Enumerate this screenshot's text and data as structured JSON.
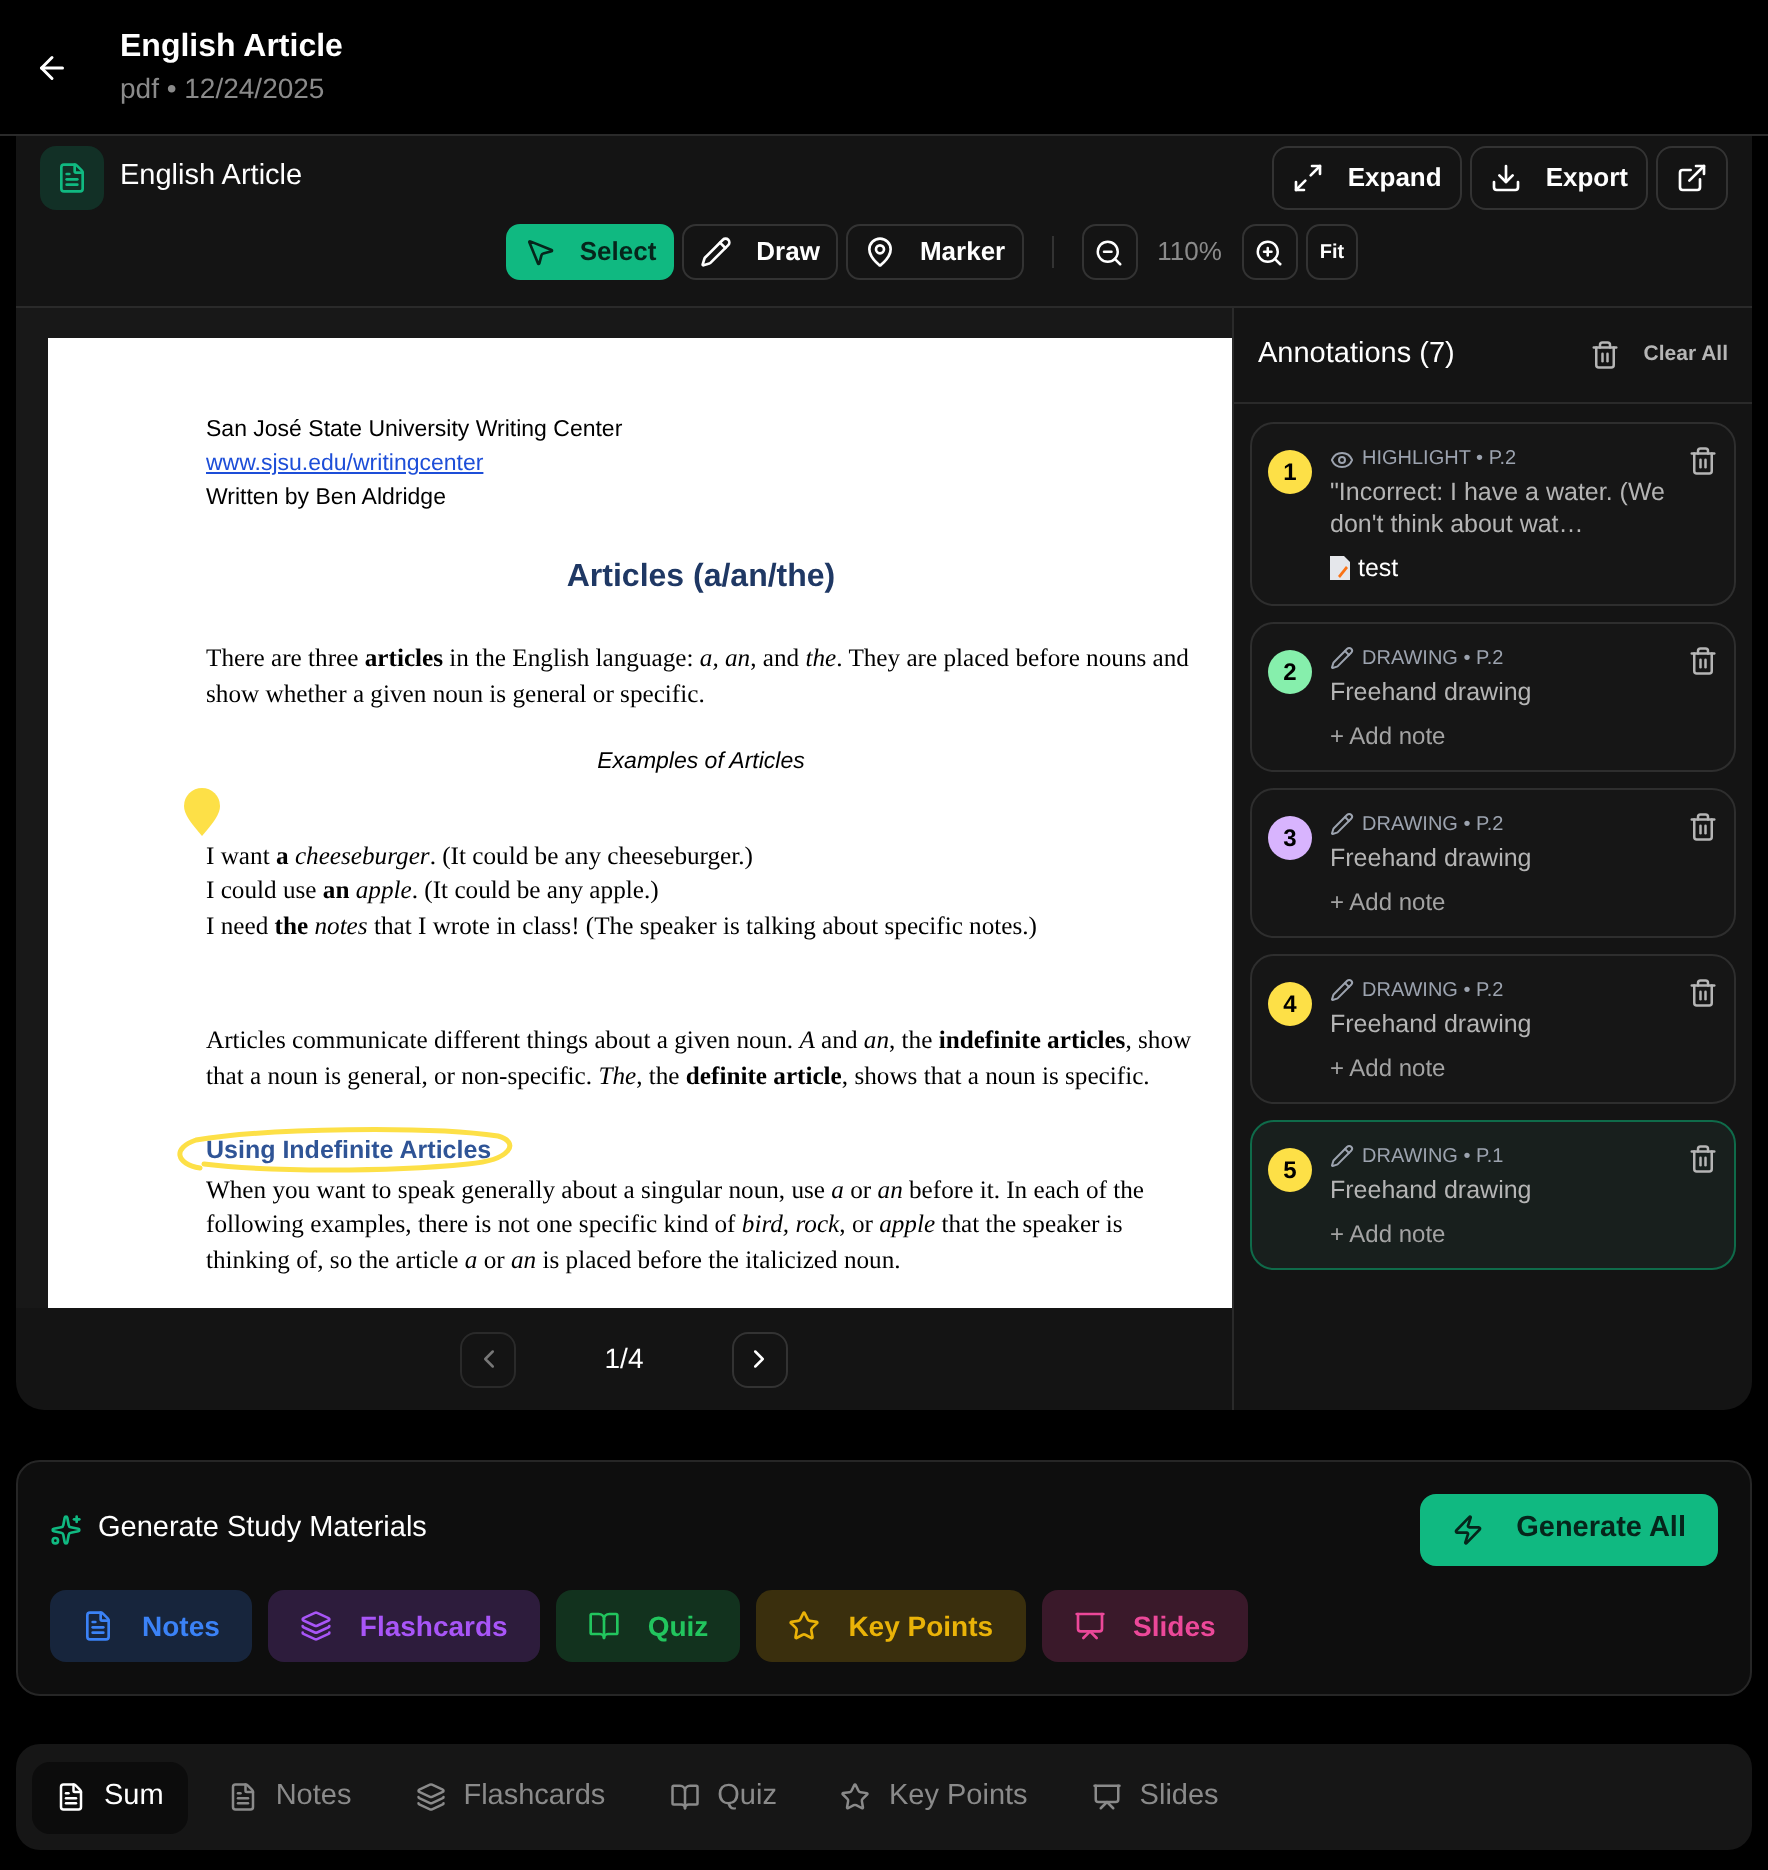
{
  "header": {
    "title": "English Article",
    "subtitle": "pdf • 12/24/2025"
  },
  "viewer": {
    "title": "English Article",
    "actions": [
      {
        "kind": "expand",
        "label": "Expand"
      },
      {
        "kind": "export",
        "label": "Export"
      },
      {
        "kind": "external"
      }
    ],
    "tools": [
      {
        "kind": "select",
        "label": "Select",
        "selected": true
      },
      {
        "kind": "draw",
        "label": "Draw",
        "selected": false
      },
      {
        "kind": "marker",
        "label": "Marker",
        "selected": false
      }
    ],
    "zoom": "110%",
    "fit": "Fit",
    "document": {
      "header_lines": [
        "San José State University Writing Center",
        "www.sjsu.edu/writingcenter",
        "Written by Ben Aldridge"
      ],
      "title": "Articles (a/an/the)",
      "blocks": [
        {
          "kind": "para",
          "text": "There are three **articles** in the English language: *a, an*, and *the*. They are placed before nouns and show whether a given noun is general or specific."
        },
        {
          "kind": "caption",
          "text": "Examples of Articles"
        },
        {
          "kind": "lines",
          "marker": true,
          "lines": [
            "I want **a** *cheeseburger*. (It could be any cheeseburger.)",
            "I could use **an** *apple*. (It could be any apple.)",
            "I need **the** *notes* that I wrote in class! (The speaker is talking about specific notes.)"
          ]
        },
        {
          "kind": "para",
          "text": "Articles communicate different things about a given noun. *A* and *an*, the **indefinite articles**, show that a noun is general, or non-specific. *The*, the **definite article**, shows that a noun is specific."
        },
        {
          "kind": "heading",
          "circled": true,
          "text": "Using Indefinite Articles"
        },
        {
          "kind": "para",
          "text": "When you want to speak generally about a singular noun, use *a* or *an* before it. In each of the following examples, there is not one specific kind of *bird, rock*, or *apple* that the speaker is thinking of, so the article *a* or *an* is placed before the italicized noun."
        }
      ]
    },
    "page": "1/4"
  },
  "annotations": {
    "title": "Annotations (7)",
    "clear_label": "Clear All",
    "items": [
      {
        "number": "1",
        "color": "#fde047",
        "kind": "highlight",
        "meta": "HIGHLIGHT • P.2",
        "text": "\"Incorrect: I have a water. (We don't think about wat…",
        "note": "test",
        "selected": false
      },
      {
        "number": "2",
        "color": "#86efac",
        "kind": "drawing",
        "meta": "DRAWING • P.2",
        "text": "Freehand drawing",
        "add_note": "+ Add note",
        "selected": false
      },
      {
        "number": "3",
        "color": "#d8b4fe",
        "kind": "drawing",
        "meta": "DRAWING • P.2",
        "text": "Freehand drawing",
        "add_note": "+ Add note",
        "selected": false
      },
      {
        "number": "4",
        "color": "#fde047",
        "kind": "drawing",
        "meta": "DRAWING • P.2",
        "text": "Freehand drawing",
        "add_note": "+ Add note",
        "selected": false
      },
      {
        "number": "5",
        "color": "#fde047",
        "kind": "drawing",
        "meta": "DRAWING • P.1",
        "text": "Freehand drawing",
        "add_note": "+ Add note",
        "selected": true
      }
    ]
  },
  "study": {
    "title": "Generate Study Materials",
    "generate_all": "Generate All",
    "items": [
      {
        "kind": "notes",
        "label": "Notes",
        "color": "#3b82f6"
      },
      {
        "kind": "flashcards",
        "label": "Flashcards",
        "color": "#a855f7"
      },
      {
        "kind": "quiz",
        "label": "Quiz",
        "color": "#22c55e"
      },
      {
        "kind": "keypoints",
        "label": "Key Points",
        "color": "#eab308"
      },
      {
        "kind": "slides",
        "label": "Slides",
        "color": "#ec4899"
      }
    ]
  },
  "tabs": [
    {
      "kind": "summary",
      "label": "Sum",
      "selected": true
    },
    {
      "kind": "notes",
      "label": "Notes",
      "selected": false
    },
    {
      "kind": "flashcards",
      "label": "Flashcards",
      "selected": false
    },
    {
      "kind": "quiz",
      "label": "Quiz",
      "selected": false
    },
    {
      "kind": "keypoints",
      "label": "Key Points",
      "selected": false
    },
    {
      "kind": "slides",
      "label": "Slides",
      "selected": false
    }
  ]
}
